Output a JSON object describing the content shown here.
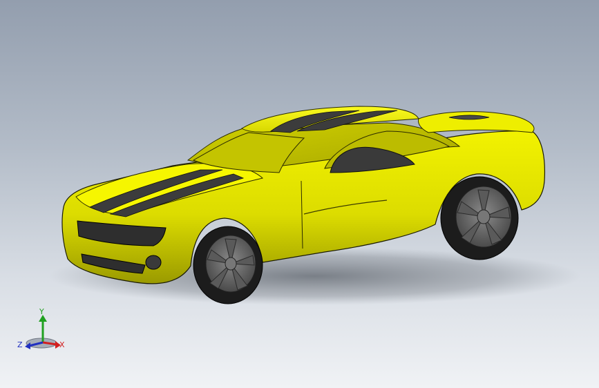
{
  "viewport": {
    "background_top": "#939eae",
    "background_bottom": "#f0f2f5"
  },
  "model": {
    "body_color": "#e6e600",
    "stripe_color": "#3c3c3c",
    "tire_color": "#1e1e1e",
    "rim_color": "#6e6e6e"
  },
  "triad": {
    "x_label": "X",
    "y_label": "Y",
    "z_label": "Z",
    "x_color": "#d22020",
    "y_color": "#20a020",
    "z_color": "#2030c0"
  }
}
